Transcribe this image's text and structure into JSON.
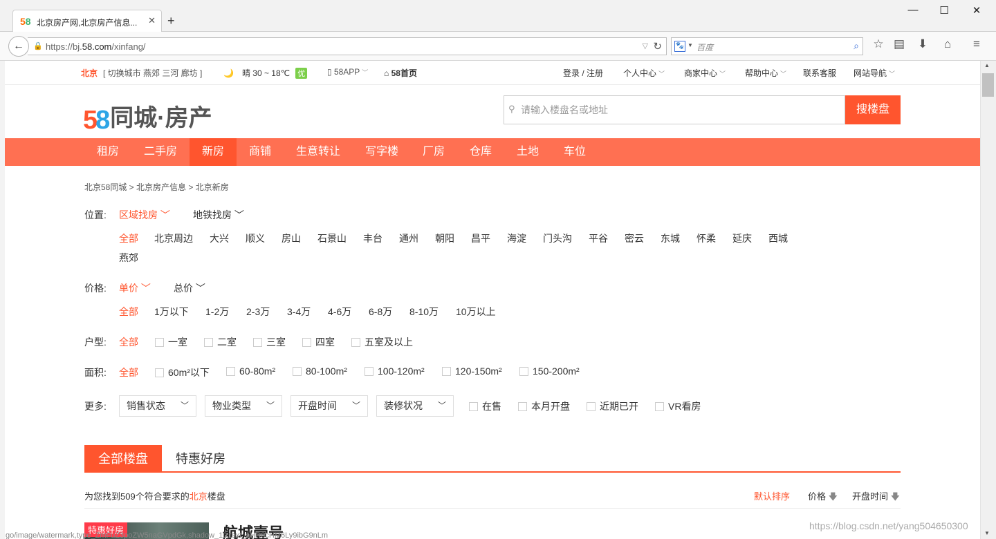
{
  "browser": {
    "tab_title": "北京房产网,北京房产信息...",
    "favicon": "58",
    "url_prefix": "https://bj.",
    "url_domain": "58.com",
    "url_path": "/xinfang/",
    "search_placeholder": "百度",
    "icons": [
      "back-arrow-icon",
      "lock-icon",
      "reload-icon",
      "baidu-icon",
      "search-icon",
      "star-icon",
      "reader-icon",
      "download-icon",
      "home-icon",
      "menu-icon"
    ]
  },
  "topbar": {
    "city": "北京",
    "switch_text": "[ 切换城市  燕郊  三河  廊坊 ]",
    "weather": "晴   30 ~ 18℃",
    "air_quality": "优",
    "app": "58APP",
    "home": "58首页",
    "login": "登录 / 注册",
    "personal": "个人中心",
    "merchant": "商家中心",
    "help": "帮助中心",
    "service": "联系客服",
    "sitenav": "网站导航"
  },
  "header": {
    "logo_text": "同城·房产",
    "search_placeholder": "请输入楼盘名或地址",
    "search_button": "搜楼盘"
  },
  "nav": [
    "租房",
    "二手房",
    "新房",
    "商铺",
    "生意转让",
    "写字楼",
    "厂房",
    "仓库",
    "土地",
    "车位"
  ],
  "nav_active": "新房",
  "breadcrumb": "北京58同城 > 北京房产信息 > 北京新房",
  "filters": {
    "location": {
      "label": "位置:",
      "tabs": [
        "区域找房",
        "地铁找房"
      ],
      "options": [
        "全部",
        "北京周边",
        "大兴",
        "顺义",
        "房山",
        "石景山",
        "丰台",
        "通州",
        "朝阳",
        "昌平",
        "海淀",
        "门头沟",
        "平谷",
        "密云",
        "东城",
        "怀柔",
        "延庆",
        "西城",
        "燕郊"
      ]
    },
    "price": {
      "label": "价格:",
      "tabs": [
        "单价",
        "总价"
      ],
      "options": [
        "全部",
        "1万以下",
        "1-2万",
        "2-3万",
        "3-4万",
        "4-6万",
        "6-8万",
        "8-10万",
        "10万以上"
      ]
    },
    "layout": {
      "label": "户型:",
      "all": "全部",
      "options": [
        "一室",
        "二室",
        "三室",
        "四室",
        "五室及以上"
      ]
    },
    "area": {
      "label": "面积:",
      "all": "全部",
      "options": [
        "60m²以下",
        "60-80m²",
        "80-100m²",
        "100-120m²",
        "120-150m²",
        "150-200m²"
      ]
    },
    "more": {
      "label": "更多:",
      "dropdowns": [
        "销售状态",
        "物业类型",
        "开盘时间",
        "装修状况"
      ],
      "checks": [
        "在售",
        "本月开盘",
        "近期已开",
        "VR看房"
      ]
    }
  },
  "results": {
    "tab_all": "全部楼盘",
    "tab_deals": "特惠好房",
    "summary_pre": "为您找到509个符合要求的",
    "summary_city": "北京",
    "summary_post": "楼盘",
    "sort_default": "默认排序",
    "sort_price": "价格",
    "sort_open": "开盘时间"
  },
  "listing": {
    "badge": "特惠好房",
    "title": "航城壹号"
  },
  "overlay": {
    "watermark": "https://blog.csdn.net/yang504650300",
    "status": "go/image/watermark,type_ZmFuZ3poZW5naGVpdGk,shadow_10,text_aHR0cHM6Ly9ibG9nLm"
  },
  "colors": {
    "brand": "#ff552e",
    "nav_bg": "#ff7052"
  }
}
